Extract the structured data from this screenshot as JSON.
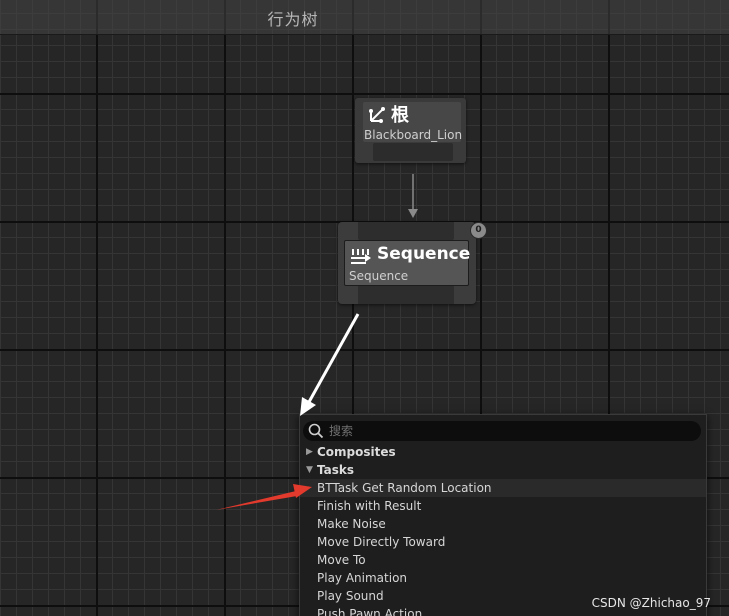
{
  "editor": {
    "title": "行为树"
  },
  "root_node": {
    "title": "根",
    "subtitle": "Blackboard_Lion",
    "icon": "root-branch-icon"
  },
  "sequence_node": {
    "title": "Sequence",
    "subtitle": "Sequence",
    "execution_index": "0",
    "icon": "sequence-arrows-icon"
  },
  "context_menu": {
    "search_placeholder": "搜索",
    "search_value": "",
    "categories": [
      {
        "label": "Composites",
        "expanded": false
      },
      {
        "label": "Tasks",
        "expanded": true
      }
    ],
    "tasks": [
      "BTTask Get Random Location",
      "Finish with Result",
      "Make Noise",
      "Move Directly Toward",
      "Move To",
      "Play Animation",
      "Play Sound",
      "Push Pawn Action"
    ]
  },
  "watermark": "CSDN @Zhichao_97",
  "colors": {
    "annotation_white": "#ffffff",
    "annotation_red": "#e23a2c",
    "menu_bg": "#1e1e1e",
    "graph_bg": "#262626"
  }
}
